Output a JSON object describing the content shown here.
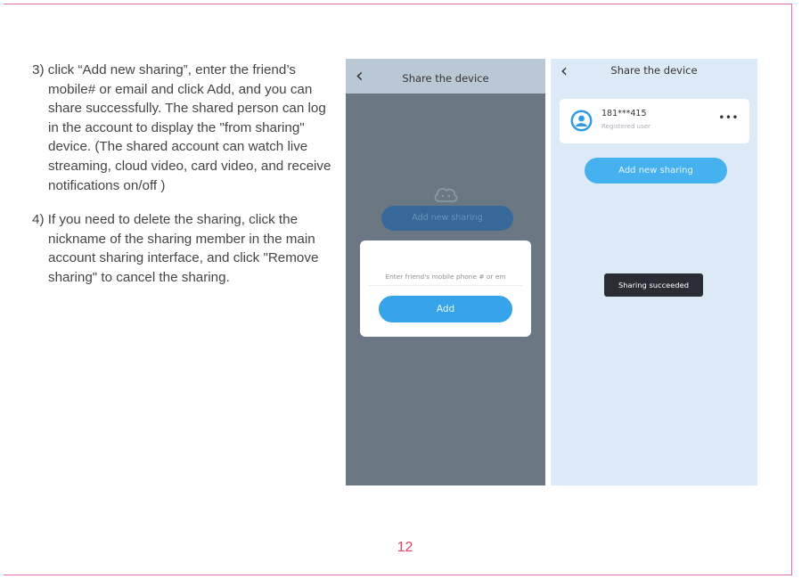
{
  "instructions": {
    "step3": "3) click “Add new sharing”, enter the friend’s mobile# or email and click Add, and you can share successfully. The shared person can log in the account to display the \"from sharing\" device. (The shared account can watch live streaming, cloud video, card video, and receive notifications on/off )",
    "step4": "4) If you need to delete the sharing, click the nickname of  the sharing member in the main account sharing interface, and click \"Remove sharing\" to cancel the sharing."
  },
  "screenshot1": {
    "title": "Share the device",
    "back_icon": "chevron-left-icon",
    "background_button": "Add new sharing",
    "dialog": {
      "placeholder": "Enter friend's mobile phone # or em",
      "add_label": "Add"
    },
    "colors": {
      "overlay": "#6b7884",
      "accent": "#36a3ea"
    }
  },
  "screenshot2": {
    "title": "Share the device",
    "back_icon": "chevron-left-icon",
    "member": {
      "id": "181***415",
      "status": "Registered user",
      "more_icon": "more-horizontal-icon"
    },
    "add_button": "Add new sharing",
    "toast": "Sharing succeeded",
    "colors": {
      "background": "#dceaf7",
      "accent": "#45b1ee"
    }
  },
  "page_number": "12",
  "colors": {
    "frame": "#e46bb3",
    "page_number": "#e0445f"
  }
}
